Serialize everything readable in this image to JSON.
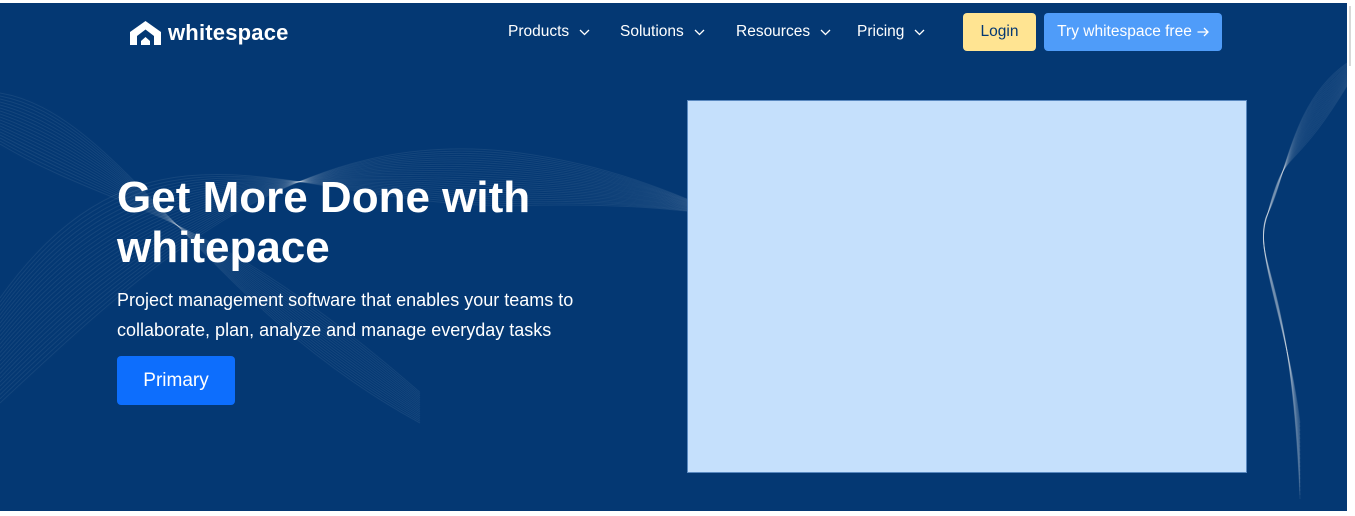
{
  "brand": {
    "name": "whitespace",
    "logo_icon": "whitespace-logo-icon"
  },
  "nav": {
    "items": [
      {
        "label": "Products",
        "icon": "chevron-down-icon"
      },
      {
        "label": "Solutions",
        "icon": "chevron-down-icon"
      },
      {
        "label": "Resources",
        "icon": "chevron-down-icon"
      },
      {
        "label": "Pricing",
        "icon": "chevron-down-icon"
      }
    ],
    "login_label": "Login",
    "try_label": "Try whitespace free",
    "try_icon": "arrow-right-icon"
  },
  "hero": {
    "headline": "Get More Done with whitepace",
    "subtext": "Project management software that enables your teams to collaborate, plan, analyze and manage everyday tasks",
    "primary_label": "Primary"
  },
  "colors": {
    "background": "#043873",
    "login_button": "#FFE492",
    "try_button": "#4F9CF9",
    "primary_button": "#0D6EFD",
    "hero_image_placeholder": "#C5E0FC"
  }
}
